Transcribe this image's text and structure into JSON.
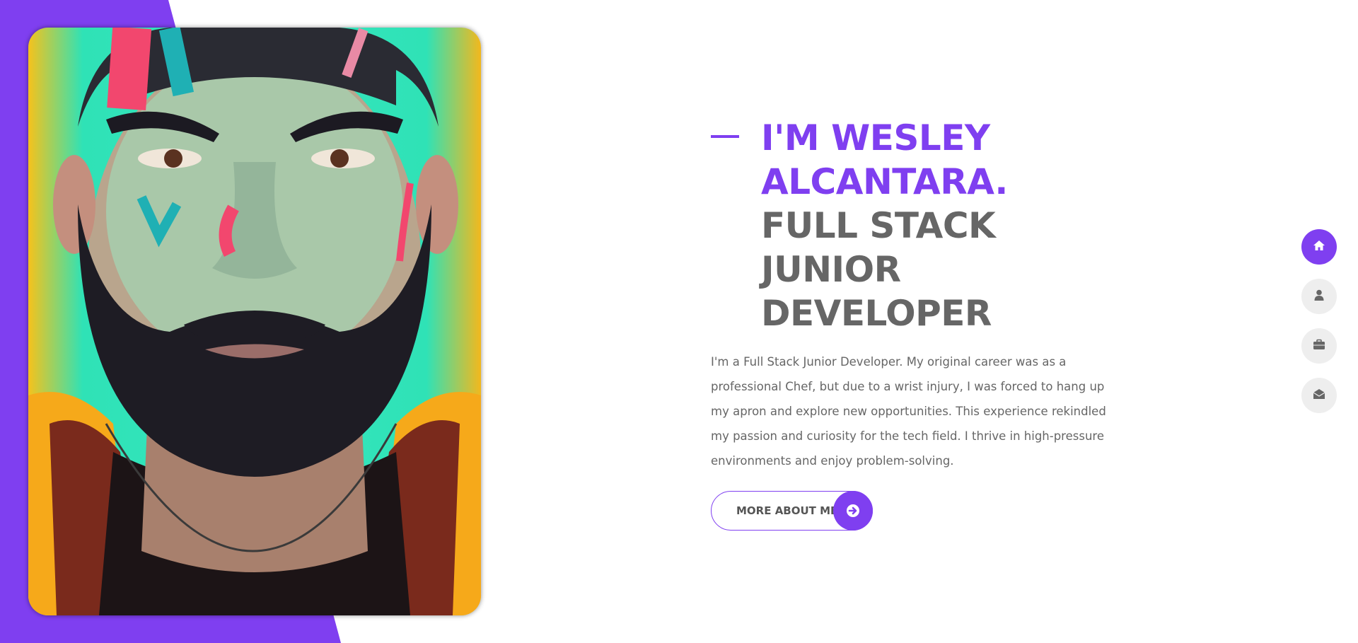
{
  "hero": {
    "name_line": "I'M WESLEY ALCANTARA.",
    "role_line": "FULL STACK JUNIOR DEVELOPER",
    "bio": "I'm a Full Stack Junior Developer. My original career was as a professional Chef, but due to a wrist injury, I was forced to hang up my apron and explore new opportunities. This experience rekindled my passion and curiosity for the tech field. I thrive in high-pressure environments and enjoy problem-solving.",
    "button_label": "MORE ABOUT ME",
    "button_icon": "arrow-right-icon"
  },
  "nav": {
    "items": [
      {
        "id": "home",
        "icon": "home-icon",
        "active": true
      },
      {
        "id": "about",
        "icon": "user-icon",
        "active": false
      },
      {
        "id": "portfolio",
        "icon": "briefcase-icon",
        "active": false
      },
      {
        "id": "contact",
        "icon": "envelope-open-icon",
        "active": false
      }
    ]
  },
  "colors": {
    "accent": "#7f3ff0",
    "text_dark": "#666666",
    "nav_inactive": "#eeeeee"
  }
}
